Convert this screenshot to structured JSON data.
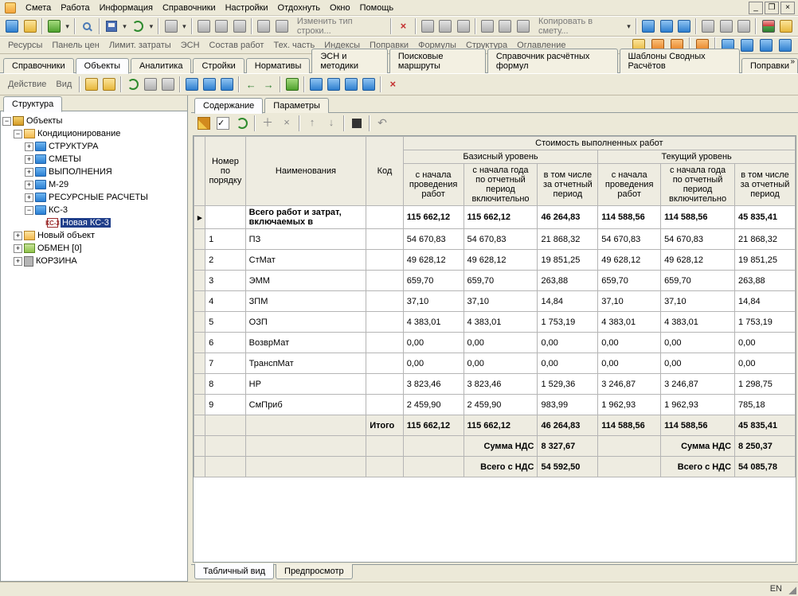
{
  "menu": [
    "Смета",
    "Работа",
    "Информация",
    "Справочники",
    "Настройки",
    "Отдохнуть",
    "Окно",
    "Помощь"
  ],
  "toolbar_text": {
    "change_row_type": "Изменить тип строки...",
    "copy_to_estimate": "Копировать в смету..."
  },
  "linkbar": [
    "Ресурсы",
    "Панель цен",
    "Лимит. затраты",
    "ЭСН",
    "Состав работ",
    "Тех. часть",
    "Индексы",
    "Поправки",
    "Формулы",
    "Структура",
    "Оглавление"
  ],
  "main_tabs": [
    "Справочники",
    "Объекты",
    "Аналитика",
    "Стройки",
    "Нормативы",
    "ЭСН и методики",
    "Поисковые маршруты",
    "Справочник расчётных формул",
    "Шаблоны Сводных Расчётов",
    "Поправки"
  ],
  "main_tab_active": 1,
  "action_menu": [
    "Действие",
    "Вид"
  ],
  "left_tab": "Структура",
  "tree": {
    "root": "Объекты",
    "items": [
      {
        "label": "Кондиционирование",
        "icon": "house",
        "expanded": true,
        "children": [
          {
            "label": "СТРУКТУРА",
            "icon": "folder"
          },
          {
            "label": "СМЕТЫ",
            "icon": "folder"
          },
          {
            "label": "ВЫПОЛНЕНИЯ",
            "icon": "folder"
          },
          {
            "label": "М-29",
            "icon": "folder"
          },
          {
            "label": "РЕСУРСНЫЕ РАСЧЕТЫ",
            "icon": "folder"
          },
          {
            "label": "КС-3",
            "icon": "folder",
            "expanded": true,
            "children": [
              {
                "label": "Новая КС-3",
                "icon": "badge",
                "badge": "КС-3",
                "selected": true
              }
            ]
          }
        ]
      },
      {
        "label": "Новый объект",
        "icon": "house"
      },
      {
        "label": "ОБМЕН  [0]",
        "icon": "swap"
      },
      {
        "label": "КОРЗИНА",
        "icon": "trash"
      }
    ]
  },
  "inner_tabs": [
    "Содержание",
    "Параметры"
  ],
  "inner_tab_active": 0,
  "grid_header": {
    "num": "Номер по порядку",
    "name": "Наименования",
    "code": "Код",
    "cost_group": "Стоимость выполненных работ",
    "base_level": "Базисный уровень",
    "cur_level": "Текущий уровень",
    "col_a": "с начала проведения работ",
    "col_b": "с начала года по отчетный период включительно",
    "col_c": "в том числе за отчетный период"
  },
  "totals_row": {
    "name": "Всего работ и затрат, включаемых в",
    "b1": "115 662,12",
    "b2": "115 662,12",
    "b3": "46 264,83",
    "c1": "114 588,56",
    "c2": "114 588,56",
    "c3": "45 835,41"
  },
  "rows": [
    {
      "n": "1",
      "name": "ПЗ",
      "b1": "54 670,83",
      "b2": "54 670,83",
      "b3": "21 868,32",
      "c1": "54 670,83",
      "c2": "54 670,83",
      "c3": "21 868,32"
    },
    {
      "n": "2",
      "name": "СтМат",
      "b1": "49 628,12",
      "b2": "49 628,12",
      "b3": "19 851,25",
      "c1": "49 628,12",
      "c2": "49 628,12",
      "c3": "19 851,25"
    },
    {
      "n": "3",
      "name": "ЭММ",
      "b1": "659,70",
      "b2": "659,70",
      "b3": "263,88",
      "c1": "659,70",
      "c2": "659,70",
      "c3": "263,88"
    },
    {
      "n": "4",
      "name": "ЗПМ",
      "b1": "37,10",
      "b2": "37,10",
      "b3": "14,84",
      "c1": "37,10",
      "c2": "37,10",
      "c3": "14,84"
    },
    {
      "n": "5",
      "name": "ОЗП",
      "b1": "4 383,01",
      "b2": "4 383,01",
      "b3": "1 753,19",
      "c1": "4 383,01",
      "c2": "4 383,01",
      "c3": "1 753,19"
    },
    {
      "n": "6",
      "name": "ВозврМат",
      "b1": "0,00",
      "b2": "0,00",
      "b3": "0,00",
      "c1": "0,00",
      "c2": "0,00",
      "c3": "0,00"
    },
    {
      "n": "7",
      "name": "ТранспМат",
      "b1": "0,00",
      "b2": "0,00",
      "b3": "0,00",
      "c1": "0,00",
      "c2": "0,00",
      "c3": "0,00"
    },
    {
      "n": "8",
      "name": "НР",
      "b1": "3 823,46",
      "b2": "3 823,46",
      "b3": "1 529,36",
      "c1": "3 246,87",
      "c2": "3 246,87",
      "c3": "1 298,75"
    },
    {
      "n": "9",
      "name": "СмПриб",
      "b1": "2 459,90",
      "b2": "2 459,90",
      "b3": "983,99",
      "c1": "1 962,93",
      "c2": "1 962,93",
      "c3": "785,18"
    }
  ],
  "footer": {
    "itogo": "Итого",
    "b1": "115 662,12",
    "b2": "115 662,12",
    "b3": "46 264,83",
    "c1": "114 588,56",
    "c2": "114 588,56",
    "c3": "45 835,41",
    "nds_label": "Сумма НДС",
    "nds_b": "8 327,67",
    "nds_c": "8 250,37",
    "total_nds_label": "Всего с НДС",
    "total_nds_b": "54 592,50",
    "total_nds_c": "54 085,78"
  },
  "bottom_tabs": [
    "Табличный вид",
    "Предпросмотр"
  ],
  "bottom_tab_active": 0,
  "status_lang": "EN"
}
